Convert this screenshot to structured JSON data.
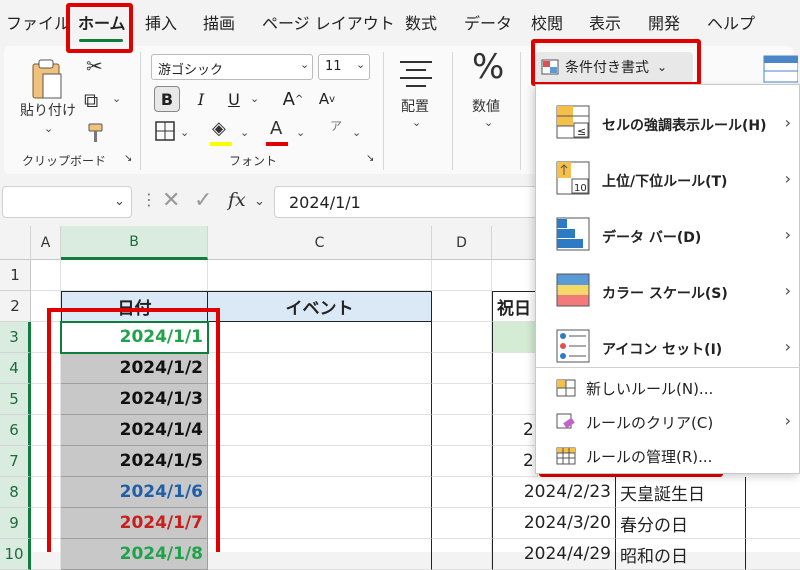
{
  "menu": {
    "tabs": [
      "ファイル",
      "ホーム",
      "挿入",
      "描画",
      "ページ レイアウト",
      "数式",
      "データ",
      "校閲",
      "表示",
      "開発",
      "ヘルプ"
    ]
  },
  "ribbon": {
    "clipboard": {
      "paste_label": "貼り付け",
      "group_label": "クリップボード"
    },
    "font": {
      "font_name": "游ゴシック",
      "font_size": "11",
      "bold": "B",
      "italic": "I",
      "underline": "U",
      "grow": "A",
      "shrink": "A",
      "color_letter": "A",
      "phonetic": "ア",
      "group_label": "フォント"
    },
    "alignment": {
      "label": "配置"
    },
    "number": {
      "symbol": "%",
      "label": "数値"
    },
    "conditional_format": {
      "label": "条件付き書式"
    }
  },
  "formula_bar": {
    "fx": "fx",
    "value": "2024/1/1"
  },
  "grid": {
    "columns": [
      "A",
      "B",
      "C",
      "D"
    ],
    "rows": [
      "1",
      "2",
      "3",
      "4",
      "5",
      "6",
      "7",
      "8",
      "9",
      "10"
    ],
    "header_b": "日付",
    "header_c": "イベント",
    "header_e": "祝日",
    "dates": [
      "2024/1/1",
      "2024/1/2",
      "2024/1/3",
      "2024/1/4",
      "2024/1/5",
      "2024/1/6",
      "2024/1/7",
      "2024/1/8"
    ],
    "date_colors": [
      "#1fa34a",
      "#111111",
      "#111111",
      "#111111",
      "#111111",
      "#1f5fa8",
      "#c81e1e",
      "#1fa34a"
    ],
    "holiday_dates": [
      "2",
      "2",
      "2024/2/23",
      "2024/3/20",
      "2024/4/29"
    ],
    "holiday_names": [
      "天皇誕生日",
      "春分の日",
      "昭和の日"
    ]
  },
  "dropdown": {
    "items": [
      {
        "label": "セルの強調表示ルール(H)"
      },
      {
        "label": "上位/下位ルール(T)"
      },
      {
        "label": "データ バー(D)"
      },
      {
        "label": "カラー スケール(S)"
      },
      {
        "label": "アイコン セット(I)"
      },
      {
        "label": "新しいルール(N)..."
      },
      {
        "label": "ルールのクリア(C)"
      },
      {
        "label": "ルールの管理(R)..."
      }
    ]
  },
  "colors": {
    "accent": "#117d3c",
    "highlight_red": "#e00000"
  }
}
